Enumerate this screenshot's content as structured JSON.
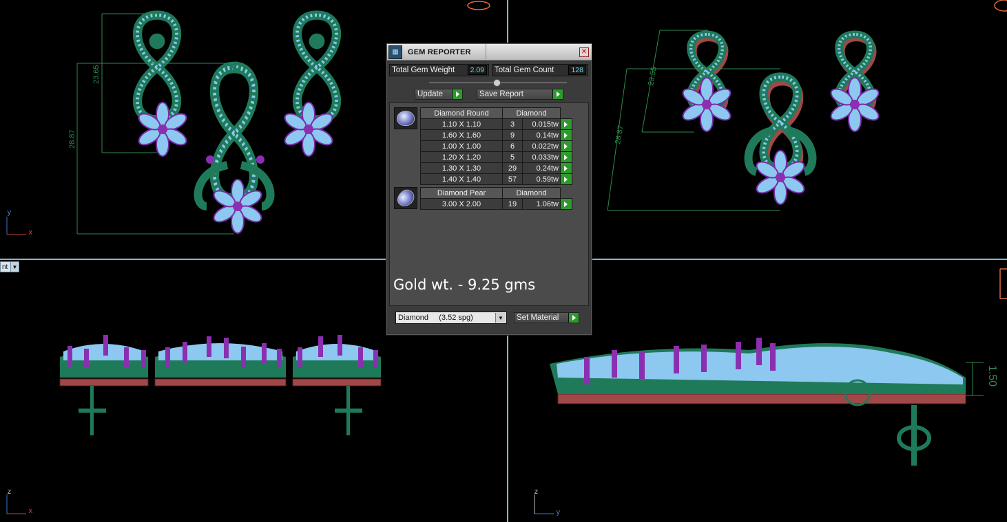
{
  "viewports": {
    "top_left": {
      "dims": [
        "23.65",
        "28.87"
      ],
      "axes": [
        "y",
        "x"
      ]
    },
    "top_right": {
      "dims": [
        "23.55",
        "28.87"
      ]
    },
    "bottom_left": {
      "axes": [
        "z",
        "x"
      ],
      "view_menu_label": "nt"
    },
    "bottom_right": {
      "dims": [
        "1.50"
      ],
      "axes": [
        "z",
        "y"
      ]
    }
  },
  "panel": {
    "title": "GEM REPORTER",
    "total_weight_label": "Total Gem Weight",
    "total_weight_value": "2.09",
    "total_count_label": "Total Gem Count",
    "total_count_value": "128",
    "update_label": "Update",
    "save_report_label": "Save Report",
    "groups": [
      {
        "shape": "Diamond Round",
        "material": "Diamond",
        "icon": "round-gem-icon",
        "rows": [
          {
            "size": "1.10 X 1.10",
            "qty": "3",
            "weight": "0.015tw"
          },
          {
            "size": "1.60 X 1.60",
            "qty": "9",
            "weight": "0.14tw"
          },
          {
            "size": "1.00 X 1.00",
            "qty": "6",
            "weight": "0.022tw"
          },
          {
            "size": "1.20 X 1.20",
            "qty": "5",
            "weight": "0.033tw"
          },
          {
            "size": "1.30 X 1.30",
            "qty": "29",
            "weight": "0.24tw"
          },
          {
            "size": "1.40 X 1.40",
            "qty": "57",
            "weight": "0.59tw"
          }
        ]
      },
      {
        "shape": "Diamond Pear",
        "material": "Diamond",
        "icon": "pear-gem-icon",
        "rows": [
          {
            "size": "3.00 X 2.00",
            "qty": "19",
            "weight": "1.06tw"
          }
        ]
      }
    ],
    "gold_note": "Gold wt. - 9.25 gms",
    "material_select": "Diamond     (3.52 spg)",
    "set_material_label": "Set Material"
  },
  "colors": {
    "metal": "#1f7a5a",
    "gem": "#8cc8f0",
    "prong": "#8a2fb0",
    "base": "#a04848",
    "dimension": "#2e8a4e",
    "divider": "#8fb4c8"
  }
}
